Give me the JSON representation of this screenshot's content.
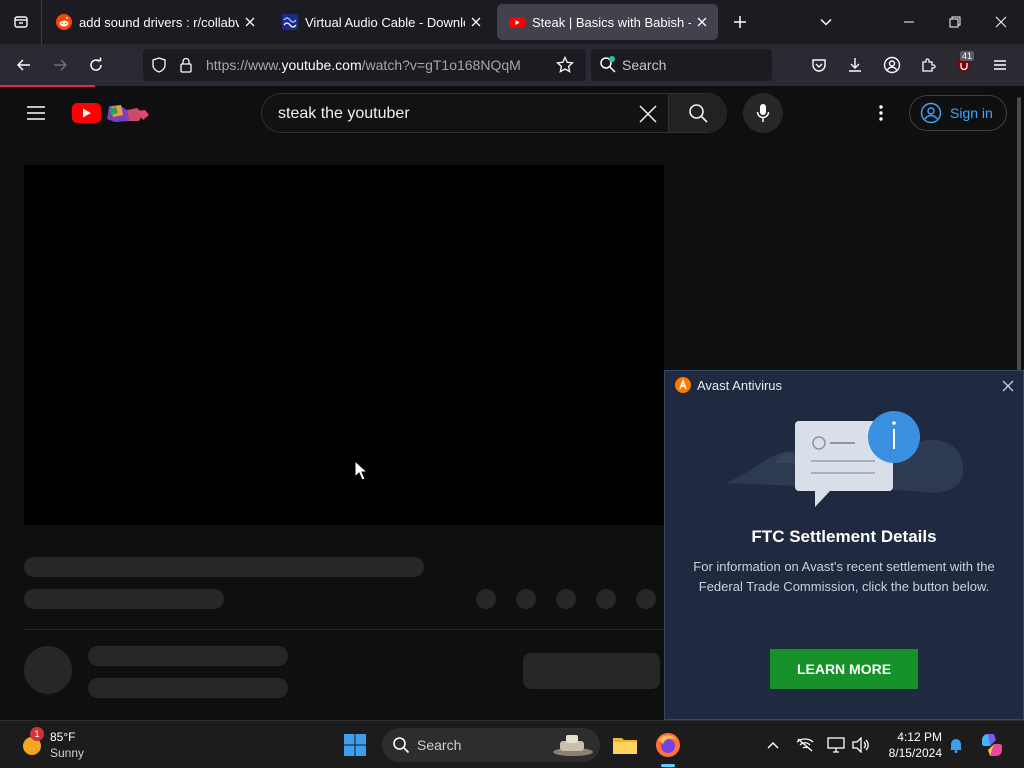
{
  "browser": {
    "tabs": [
      {
        "title": "add sound drivers : r/collabvm",
        "favicon": "reddit-icon",
        "active": false
      },
      {
        "title": "Virtual Audio Cable - Download",
        "favicon": "vac-icon",
        "active": false
      },
      {
        "title": "Steak | Basics with Babish - YouTube",
        "favicon": "youtube-icon",
        "active": true
      }
    ],
    "url_prefix": "https://www.",
    "url_domain": "youtube.com",
    "url_path": "/watch?v=gT1o168NQqM",
    "search_placeholder": "Search",
    "extension_badge": "41"
  },
  "youtube": {
    "search_query": "steak the youtuber",
    "sign_in_label": "Sign in"
  },
  "avast": {
    "app_name": "Avast Antivirus",
    "title": "FTC Settlement Details",
    "body": "For information on Avast's recent settlement with the Federal Trade Commission, click the button below.",
    "button_label": "LEARN MORE"
  },
  "taskbar": {
    "weather_temp": "85°F",
    "weather_condition": "Sunny",
    "weather_badge": "1",
    "search_placeholder": "Search",
    "time": "4:12 PM",
    "date": "8/15/2024"
  },
  "colors": {
    "accent_youtube": "#ff0000",
    "avast_button": "#17922a",
    "sign_in_blue": "#3ea6ff"
  }
}
